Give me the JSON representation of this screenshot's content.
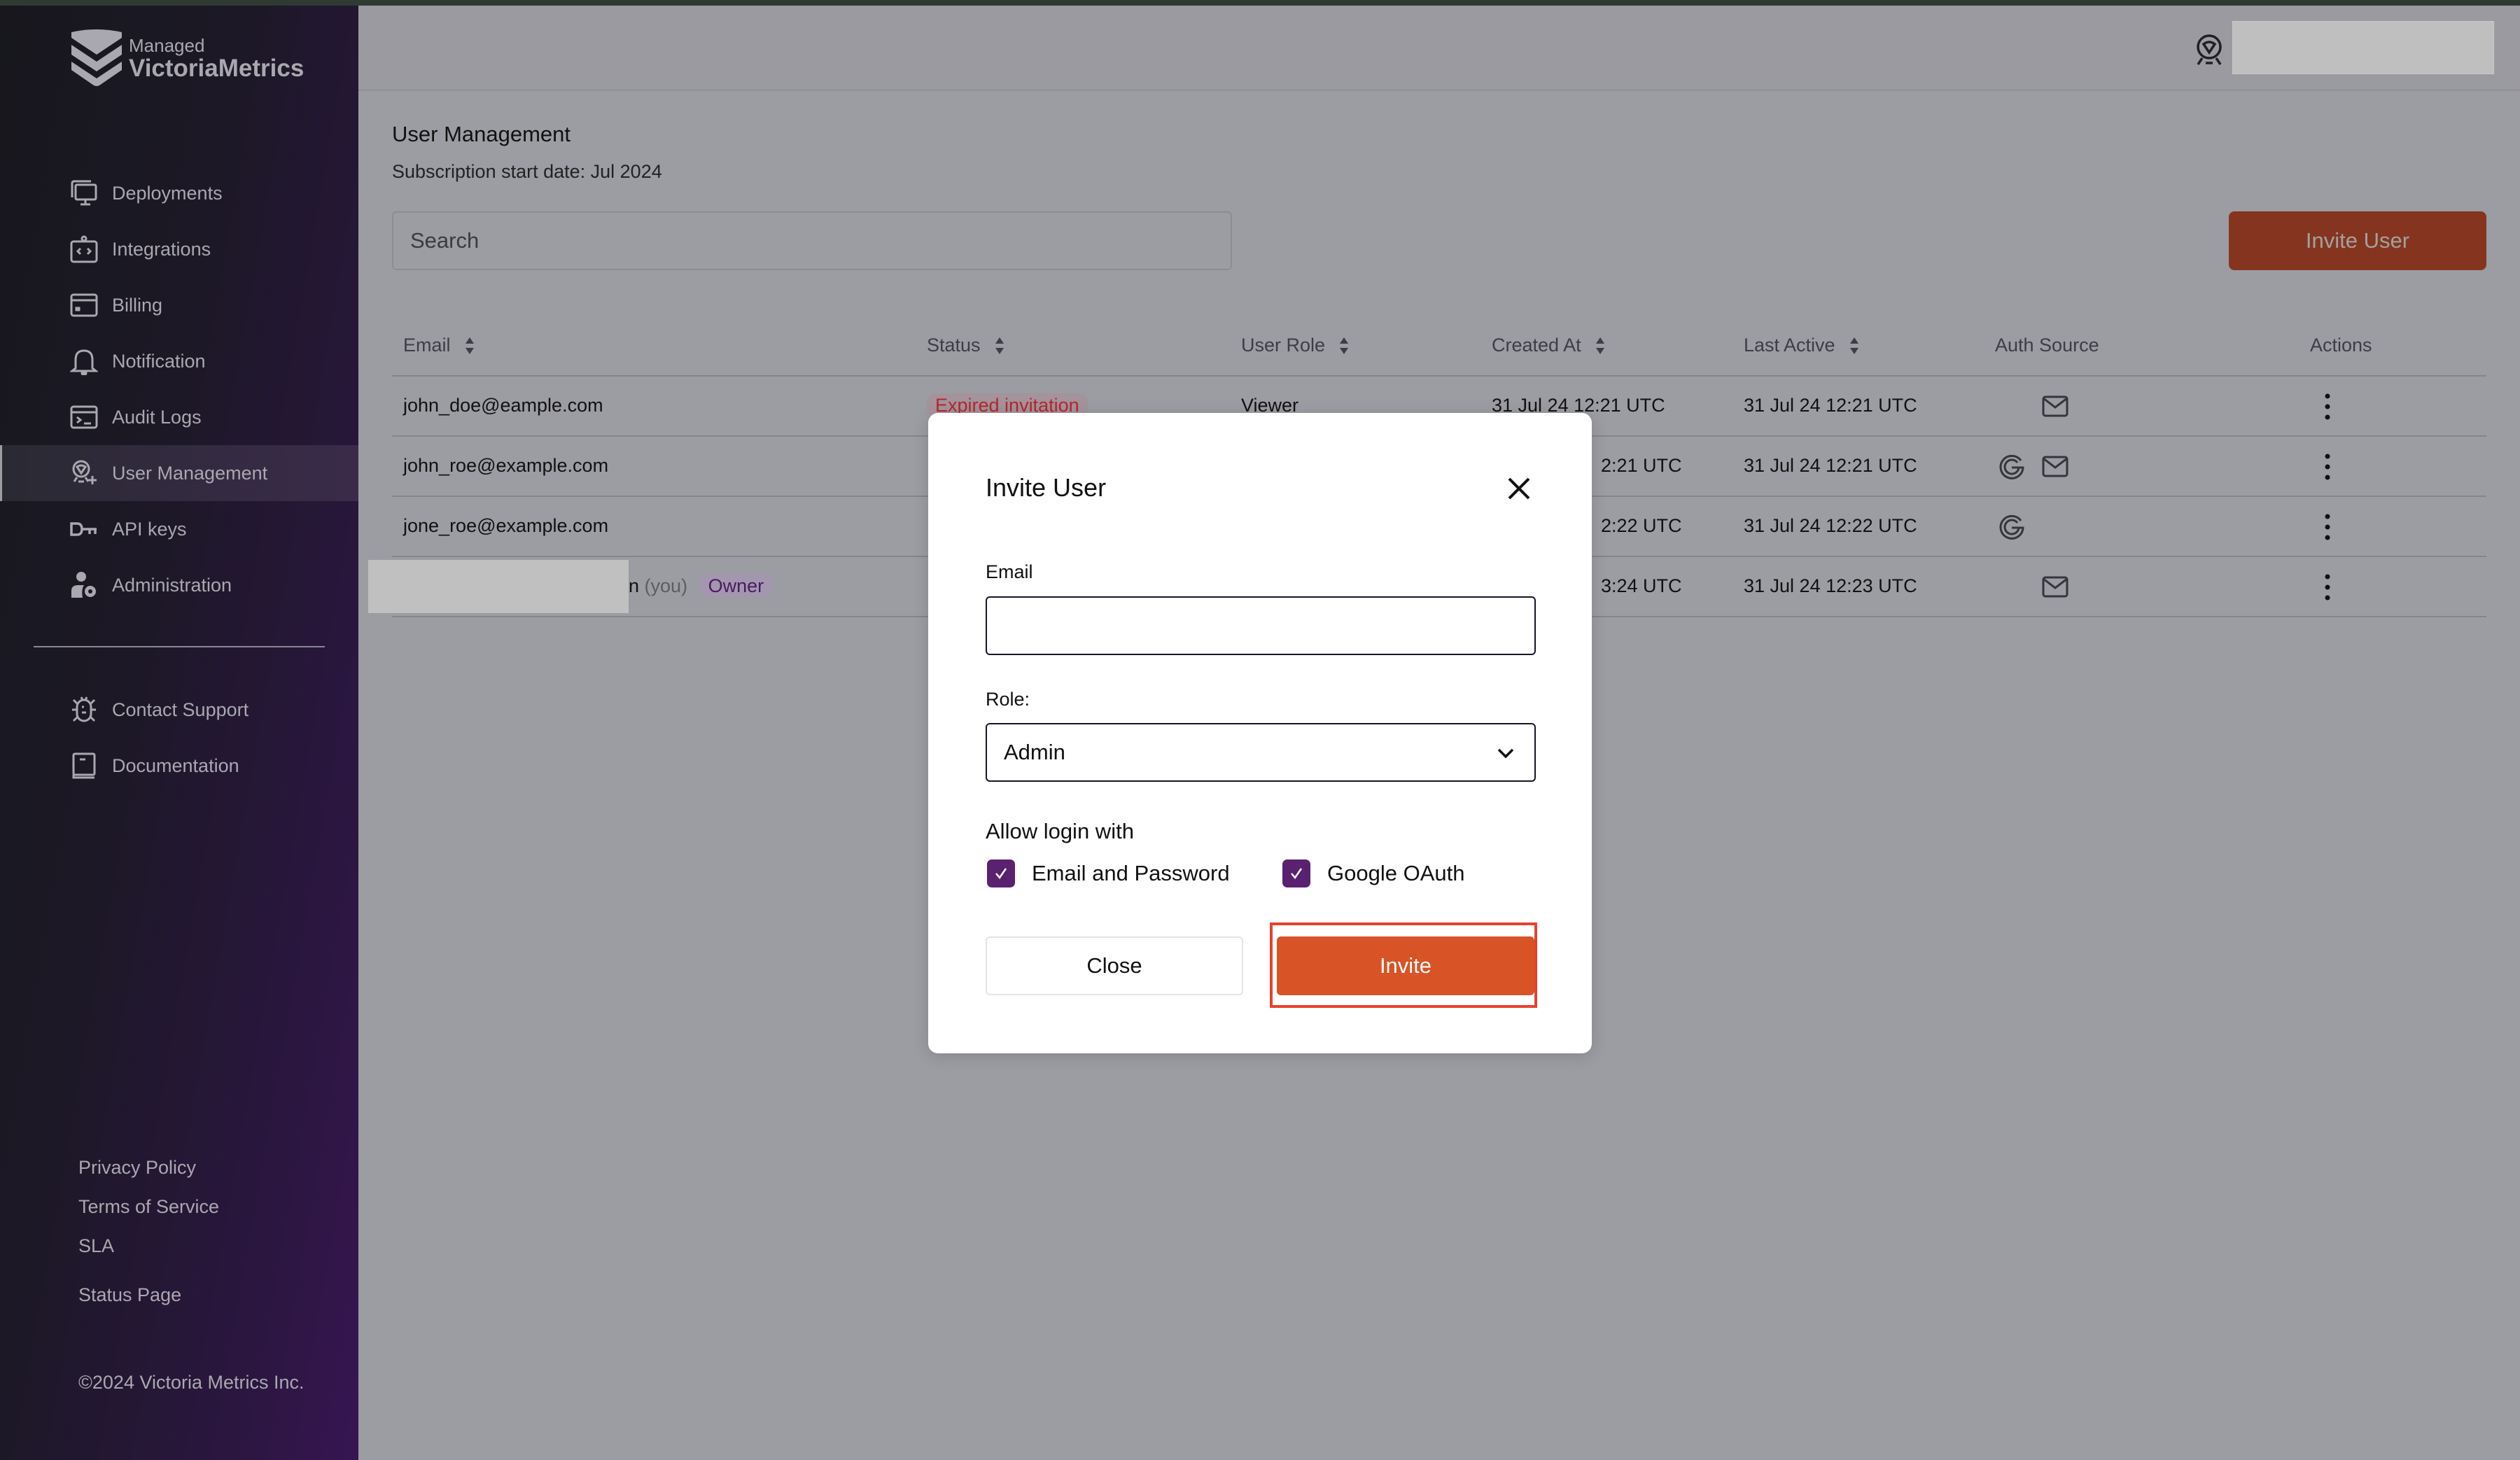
{
  "brand": {
    "line1": "Managed",
    "line2": "VictoriaMetrics"
  },
  "sidebar": {
    "items": [
      {
        "label": "Deployments",
        "icon": "monitor-icon"
      },
      {
        "label": "Integrations",
        "icon": "integration-code-icon"
      },
      {
        "label": "Billing",
        "icon": "credit-card-icon"
      },
      {
        "label": "Notification",
        "icon": "bell-icon"
      },
      {
        "label": "Audit Logs",
        "icon": "terminal-icon"
      },
      {
        "label": "User Management",
        "icon": "user-add-icon",
        "active": true
      },
      {
        "label": "API keys",
        "icon": "key-icon"
      },
      {
        "label": "Administration",
        "icon": "user-gear-icon"
      }
    ],
    "secondary": [
      {
        "label": "Contact Support",
        "icon": "bug-icon"
      },
      {
        "label": "Documentation",
        "icon": "book-icon"
      }
    ],
    "footer_links": {
      "privacy": "Privacy Policy",
      "terms": "Terms of Service",
      "sla": "SLA",
      "status": "Status Page"
    },
    "copyright": "©2024 Victoria Metrics Inc."
  },
  "header": {
    "user_icon": "user-badge-icon"
  },
  "main": {
    "title": "User Management",
    "subtitle": "Subscription start date: Jul 2024",
    "search_placeholder": "Search",
    "invite_user_label": "Invite User"
  },
  "table": {
    "columns": {
      "email": "Email",
      "status": "Status",
      "role": "User Role",
      "created": "Created At",
      "last": "Last Active",
      "auth": "Auth Source",
      "actions": "Actions"
    },
    "rows": [
      {
        "email": "john_doe@eample.com",
        "status": "Expired invitation",
        "role": "Viewer",
        "created": "31 Jul 24 12:21 UTC",
        "last": "31 Jul 24 12:21 UTC",
        "auth": [
          "email"
        ]
      },
      {
        "email": "john_roe@example.com",
        "status": "",
        "role": "",
        "created": "2:21 UTC",
        "last": "31 Jul 24 12:21 UTC",
        "auth": [
          "google",
          "email"
        ]
      },
      {
        "email": "jone_roe@example.com",
        "status": "",
        "role": "",
        "created": "2:22 UTC",
        "last": "31 Jul 24 12:22 UTC",
        "auth": [
          "google"
        ]
      },
      {
        "email_suffix": "n",
        "you": "(you)",
        "owner": "Owner",
        "status": "",
        "role": "",
        "created": "3:24 UTC",
        "last": "31 Jul 24 12:23 UTC",
        "auth": [
          "email"
        ]
      }
    ]
  },
  "modal": {
    "title": "Invite User",
    "email_label": "Email",
    "email_value": "",
    "role_label": "Role:",
    "role_value": "Admin",
    "allow_label": "Allow login with",
    "opt_email": "Email and Password",
    "opt_email_checked": true,
    "opt_google": "Google OAuth",
    "opt_google_checked": true,
    "close_label": "Close",
    "invite_label": "Invite"
  },
  "colors": {
    "accent": "#d85326",
    "checkbox": "#5a2170",
    "expired": "#b5262f",
    "highlight": "#e8412e"
  }
}
